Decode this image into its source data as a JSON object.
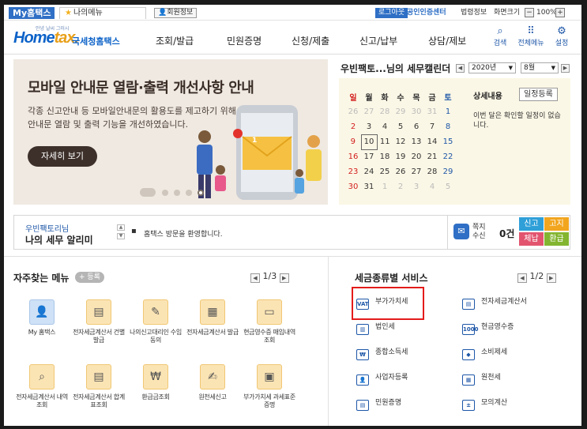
{
  "topbar": {
    "my_hometax": "My홈택스",
    "my_menu": "나의메뉴",
    "member_info": "회원정보",
    "logout": "로그아웃",
    "cert_center": "공인인증센터",
    "laws": "법령정보",
    "screen_size": "화면크기",
    "zoom_minus": "−",
    "zoom_value": "100%",
    "zoom_plus": "+"
  },
  "header": {
    "logo_small": "안녕 날씨 그러시",
    "logo_home": "Home",
    "logo_tax": "tax.",
    "logo_name": "국세청홈택스",
    "nav": [
      "조회/발급",
      "민원증명",
      "신청/제출",
      "신고/납부",
      "상담/제보"
    ],
    "search": "검색",
    "all_menu": "전체메뉴",
    "settings": "설정"
  },
  "banner": {
    "title": "모바일 안내문 열람·출력 개선사항 안내",
    "desc_line1": "각종 신고안내 등 모바일안내문의 활용도를 제고하기 위해",
    "desc_line2": "안내문 열람 및 출력 기능을 개선하였습니다.",
    "button": "자세히 보기",
    "badge": "1"
  },
  "calendar": {
    "title": "우빈팩토...님의 세무캘린더",
    "year": "2020년",
    "month": "8월",
    "weekdays": [
      "일",
      "월",
      "화",
      "수",
      "목",
      "금",
      "토"
    ],
    "weeks": [
      [
        "26",
        "27",
        "28",
        "29",
        "30",
        "31",
        "1"
      ],
      [
        "2",
        "3",
        "4",
        "5",
        "6",
        "7",
        "8"
      ],
      [
        "9",
        "10",
        "11",
        "12",
        "13",
        "14",
        "15"
      ],
      [
        "16",
        "17",
        "18",
        "19",
        "20",
        "21",
        "22"
      ],
      [
        "23",
        "24",
        "25",
        "26",
        "27",
        "28",
        "29"
      ],
      [
        "30",
        "31",
        "1",
        "2",
        "3",
        "4",
        "5"
      ]
    ],
    "detail_title": "상세내용",
    "register_schedule": "일정등록",
    "detail_text": "이번 달은 확인할 일정이 없습니다."
  },
  "notice": {
    "user_name": "우빈팩토리님",
    "title": "나의 세무 알리미",
    "message": "홈택스 방문을 환영합니다.",
    "mail_label_1": "쪽지",
    "mail_label_2": "수신",
    "mail_count": "0건",
    "tags": [
      "신고",
      "고지",
      "체납",
      "환급"
    ]
  },
  "frequent": {
    "title": "자주찾는 메뉴",
    "register": "+ 등록",
    "pager": "1/3",
    "items": [
      "My 홈택스",
      "전자세금계산서 건별발급",
      "나의신고대리인 수임동의",
      "전자세금계산서 발급",
      "현금영수증 매입내역 조회",
      "전자세금계산서 내역조회",
      "전자세금계산서 합계표조회",
      "환급금조회",
      "원천세신고",
      "부가가치세 과세표준증명"
    ]
  },
  "taxservice": {
    "title": "세금종류별 서비스",
    "pager": "1/2",
    "items_left": [
      "부가가치세",
      "법인세",
      "종합소득세",
      "사업자등록",
      "민원증명"
    ],
    "items_right": [
      "전자세금계산서",
      "현금영수증",
      "소비제세",
      "원천세",
      "모의계산"
    ]
  }
}
